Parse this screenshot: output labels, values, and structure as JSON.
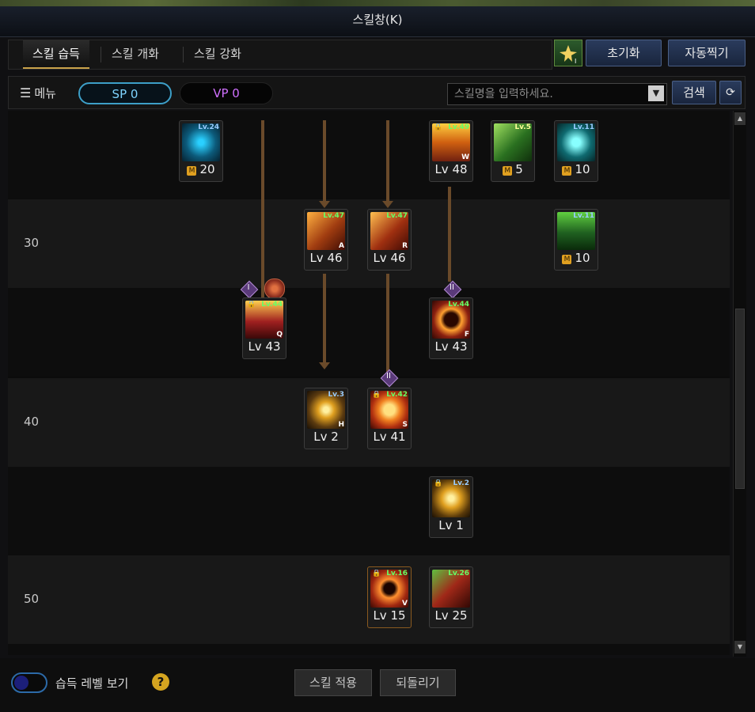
{
  "window": {
    "title": "스킬창(K)"
  },
  "tabs": [
    {
      "label": "스킬 습득",
      "active": true
    },
    {
      "label": "스킬 개화",
      "active": false
    },
    {
      "label": "스킬 강화",
      "active": false
    }
  ],
  "header_buttons": {
    "reset": "초기화",
    "auto": "자동찍기"
  },
  "toolbar": {
    "menu_label": "메뉴",
    "sp": "SP 0",
    "vp": "VP 0",
    "search_placeholder": "스킬명을 입력하세요.",
    "search_button": "검색"
  },
  "level_rows": [
    "30",
    "40",
    "50"
  ],
  "skills": [
    {
      "id": "s1",
      "badge": "Lv.24",
      "label": "20",
      "mastery": true,
      "key": "",
      "locked": false,
      "color": "#0c5a7a"
    },
    {
      "id": "s2",
      "badge": "Lv.49",
      "label": "Lv 48",
      "mastery": false,
      "key": "W",
      "locked": true,
      "color": "#b04010"
    },
    {
      "id": "s3",
      "badge": "Lv.5",
      "label": "5",
      "mastery": true,
      "key": "",
      "locked": false,
      "color": "#2a7020"
    },
    {
      "id": "s4",
      "badge": "Lv.11",
      "label": "10",
      "mastery": true,
      "key": "",
      "locked": false,
      "color": "#0f6a70"
    },
    {
      "id": "s5",
      "badge": "Lv.47",
      "label": "Lv 46",
      "mastery": false,
      "key": "A",
      "locked": false,
      "color": "#a03c10"
    },
    {
      "id": "s6",
      "badge": "Lv.47",
      "label": "Lv 46",
      "mastery": false,
      "key": "R",
      "locked": false,
      "color": "#a03010"
    },
    {
      "id": "s7",
      "badge": "Lv.11",
      "label": "10",
      "mastery": true,
      "key": "",
      "locked": false,
      "color": "#1f6020"
    },
    {
      "id": "s8",
      "badge": "Lv.44",
      "label": "Lv 43",
      "mastery": false,
      "key": "Q",
      "locked": true,
      "color": "#a02020"
    },
    {
      "id": "s9",
      "badge": "Lv.44",
      "label": "Lv 43",
      "mastery": false,
      "key": "F",
      "locked": false,
      "color": "#8a2010"
    },
    {
      "id": "s10",
      "badge": "Lv.3",
      "label": "Lv 2",
      "mastery": false,
      "key": "H",
      "locked": false,
      "color": "#5a3a10"
    },
    {
      "id": "s11",
      "badge": "Lv.42",
      "label": "Lv 41",
      "mastery": false,
      "key": "S",
      "locked": true,
      "color": "#b03010"
    },
    {
      "id": "s12",
      "badge": "Lv.2",
      "label": "Lv 1",
      "mastery": false,
      "key": "",
      "locked": true,
      "color": "#5a3a0a"
    },
    {
      "id": "s13",
      "badge": "Lv.16",
      "label": "Lv 15",
      "mastery": false,
      "key": "V",
      "locked": true,
      "color": "#a02810"
    },
    {
      "id": "s14",
      "badge": "Lv.26",
      "label": "Lv 25",
      "mastery": false,
      "key": "",
      "locked": false,
      "color": "#a02818"
    }
  ],
  "markers": {
    "tier1": "I",
    "tier2": "II"
  },
  "bottom": {
    "show_level": "습득 레벨 보기",
    "help": "?",
    "apply": "스킬 적용",
    "revert": "되돌리기"
  }
}
